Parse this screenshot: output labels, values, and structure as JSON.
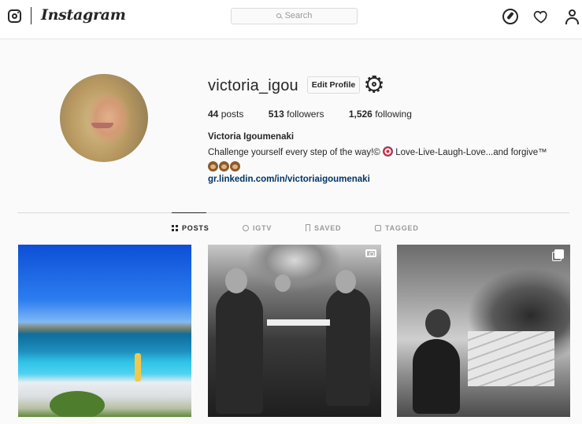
{
  "nav": {
    "brand": "Instagram",
    "search_placeholder": "Search",
    "icons": [
      "instagram-glyph-icon",
      "compass-icon",
      "heart-icon",
      "profile-icon"
    ]
  },
  "profile": {
    "username": "victoria_igou",
    "edit_profile_label": "Edit Profile",
    "stats": {
      "posts_count": "44",
      "posts_label": "posts",
      "followers_count": "513",
      "followers_label": "followers",
      "following_count": "1,526",
      "following_label": "following"
    },
    "full_name": "Victoria Igoumenaki",
    "bio_part1": "Challenge yourself every step of the way!©",
    "bio_part2": "Love-Live-Laugh-Love...and forgive™",
    "link": "gr.linkedin.com/in/victoriaigoumenaki"
  },
  "tabs": [
    {
      "label": "POSTS",
      "active": true
    },
    {
      "label": "IGTV",
      "active": false
    },
    {
      "label": "SAVED",
      "active": false
    },
    {
      "label": "TAGGED",
      "active": false
    }
  ],
  "posts": [
    {
      "kind": "photo",
      "badge": ""
    },
    {
      "kind": "video",
      "badge": "video-icon"
    },
    {
      "kind": "carousel",
      "badge": "multiple-photos-icon"
    }
  ],
  "colors": {
    "text": "#262626",
    "muted": "#999999",
    "link": "#003569",
    "background": "#fafafa",
    "border": "#dbdbdb"
  }
}
